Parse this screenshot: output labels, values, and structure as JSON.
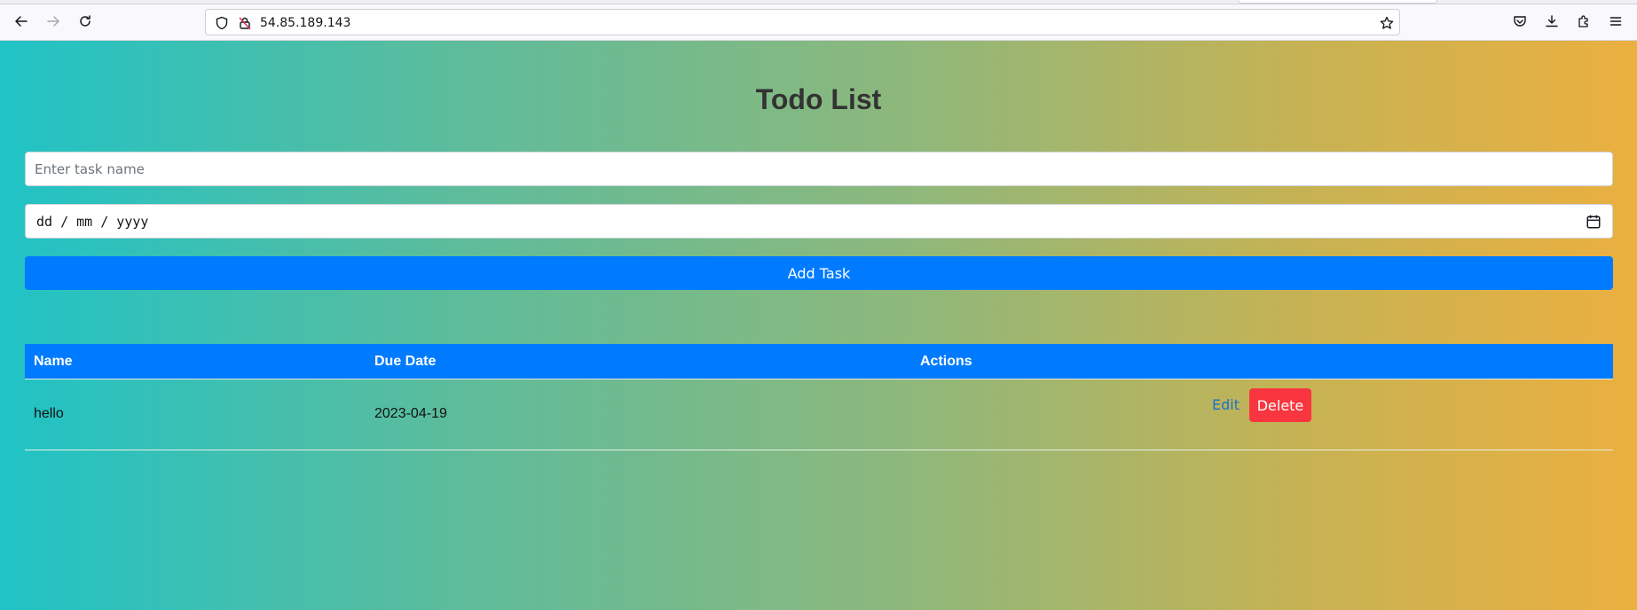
{
  "browser": {
    "url": "54.85.189.143",
    "icons": [
      "back-icon",
      "forward-icon",
      "reload-icon",
      "shield-icon",
      "insecure-lock-icon",
      "bookmark-star-icon",
      "pocket-icon",
      "download-icon",
      "extensions-icon",
      "menu-icon"
    ]
  },
  "app": {
    "title": "Todo List",
    "task_input_placeholder": "Enter task name",
    "task_input_value": "",
    "date_placeholder": "dd / mm / yyyy",
    "add_button": "Add Task"
  },
  "table": {
    "headers": [
      "Name",
      "Due Date",
      "Actions"
    ],
    "rows": [
      {
        "name": "hello",
        "due_date": "2023-04-19",
        "edit_label": "Edit",
        "delete_label": "Delete"
      }
    ]
  },
  "colors": {
    "primary": "#007bff",
    "danger": "#f9363f",
    "gradient_start": "#20c3c6",
    "gradient_end": "#ebb040"
  }
}
